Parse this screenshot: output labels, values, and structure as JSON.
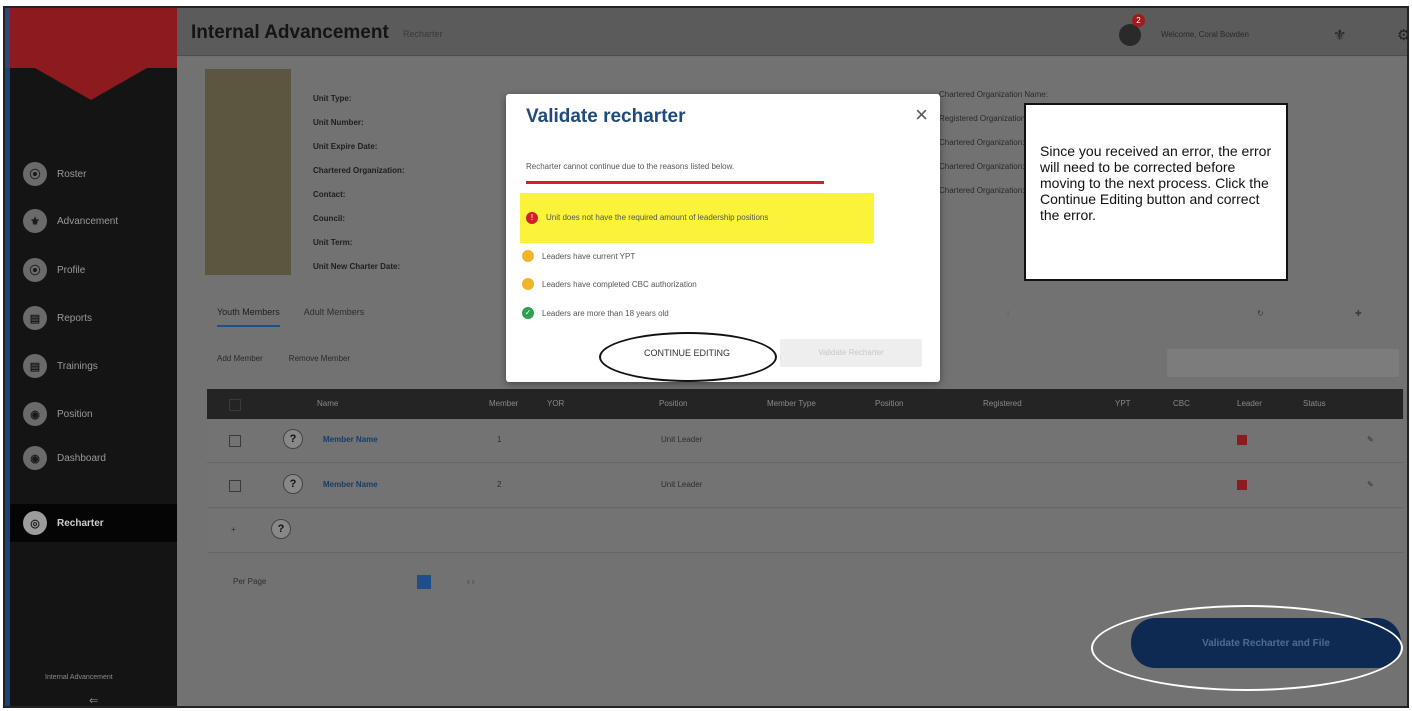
{
  "app": {
    "title": "Internal Advancement",
    "subtitle": "Recharter",
    "notification_count": "2",
    "welcome_text": "Welcome, Coral Bowden"
  },
  "sidebar": {
    "items": [
      {
        "label": "Roster",
        "icon": "roster-icon",
        "glyph": "⦿"
      },
      {
        "label": "Advancement",
        "icon": "advancement-icon",
        "glyph": "⚜"
      },
      {
        "label": "Profile",
        "icon": "profile-icon",
        "glyph": "⦿"
      },
      {
        "label": "Reports",
        "icon": "reports-icon",
        "glyph": "▤"
      },
      {
        "label": "Trainings",
        "icon": "trainings-icon",
        "glyph": "▤"
      },
      {
        "label": "Position",
        "icon": "position-icon",
        "glyph": "◉"
      },
      {
        "label": "Dashboard",
        "icon": "dashboard-icon",
        "glyph": "◉"
      },
      {
        "label": "Recharter",
        "icon": "recharter-icon",
        "glyph": "◎",
        "active": true
      }
    ],
    "footer": "Internal Advancement"
  },
  "unit_info": {
    "unit_type": "Unit Type:",
    "unit_number": "Unit Number:",
    "unit_expire": "Unit Expire Date:",
    "chartered_org": "Chartered Organization:",
    "contact": "Contact:",
    "council": "Council:",
    "unit_term": "Unit Term:",
    "unit_new": "Unit New Charter Date:"
  },
  "right_info": {
    "line1": "Chartered Organization Name:",
    "line2": "Registered Organization:",
    "line3": "Chartered Organization:",
    "line4": "Chartered Organization:",
    "line5": "Chartered Organization:"
  },
  "tabs": {
    "active": "Youth Members",
    "other": "Adult Members"
  },
  "actions": {
    "add": "Add Member",
    "remove": "Remove Member"
  },
  "table": {
    "headers": [
      "Name",
      "Member",
      "YOR",
      "Position",
      "Member Type",
      "Position",
      "Registered",
      "YPT",
      "CBC",
      "Leader",
      "Status"
    ],
    "rows": [
      {
        "name": "Member Name",
        "id": "1",
        "position": "Unit Leader"
      },
      {
        "name": "Member Name",
        "id": "2",
        "position": "Unit Leader"
      }
    ]
  },
  "pager": {
    "label": "Per Page"
  },
  "primary_button": "Validate Recharter and File",
  "modal": {
    "title": "Validate recharter",
    "close": "×",
    "reason": "Recharter cannot continue due to the reasons listed below.",
    "checks": [
      {
        "label": "Unit does not have the required amount of leadership positions",
        "status": "error",
        "color": "#d0202a"
      },
      {
        "label": "Leaders have current YPT",
        "status": "warning",
        "color": "#f0b428"
      },
      {
        "label": "Leaders have completed CBC authorization",
        "status": "warning",
        "color": "#f0b428"
      },
      {
        "label": "Leaders are more than 18 years old",
        "status": "success",
        "color": "#2e9e4f"
      }
    ],
    "continue_button": "CONTINUE EDITING",
    "disabled_button": "Validate Recharter"
  },
  "callout": {
    "text": "Since you received an error, the error will need to be corrected before moving to the next process. Click the Continue Editing button and correct the error."
  }
}
